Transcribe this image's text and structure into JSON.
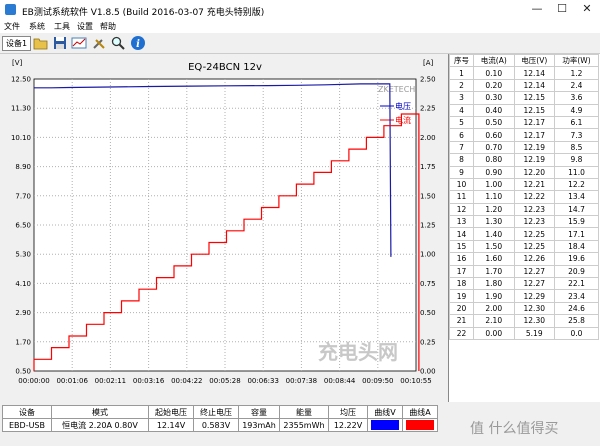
{
  "window": {
    "title": "EB测试系统软件 V1.8.5 (Build 2016-03-07 充电头特别版)",
    "minimize": "—",
    "maximize": "☐",
    "close": "✕"
  },
  "menu": [
    "文件",
    "系统",
    "工具",
    "设置",
    "帮助"
  ],
  "toolbar": {
    "device_button": "设备1",
    "icons": [
      "folder-open-icon",
      "save-icon",
      "chart-view-icon",
      "tools-icon",
      "zoom-icon",
      "info-icon"
    ]
  },
  "chart_data": {
    "type": "line",
    "title": "EQ-24BCN 12v",
    "left_axis_unit": "[V]",
    "right_axis_unit": "[A]",
    "left_ticks": [
      "12.50",
      "11.30",
      "10.10",
      "8.90",
      "7.70",
      "6.50",
      "5.30",
      "4.10",
      "2.90",
      "1.70",
      "0.50"
    ],
    "right_ticks": [
      "2.50",
      "2.25",
      "2.00",
      "1.75",
      "1.50",
      "1.25",
      "1.00",
      "0.75",
      "0.50",
      "0.25",
      "0.00"
    ],
    "x_ticks": [
      "00:00:00",
      "00:01:06",
      "00:02:11",
      "00:03:16",
      "00:04:22",
      "00:05:28",
      "00:06:33",
      "00:07:38",
      "00:08:44",
      "00:09:50",
      "00:10:55"
    ],
    "ylim_left": [
      0.5,
      12.5
    ],
    "ylim_right": [
      0.0,
      2.5
    ],
    "watermark": "ZKETECH",
    "legend": [
      {
        "name": "电压",
        "color": "#0000cc"
      },
      {
        "name": "电流",
        "color": "#ff0000"
      }
    ],
    "voltage_series": {
      "name": "电压",
      "color": "#1a1aa8",
      "x": [
        0,
        30,
        60,
        130,
        200,
        270,
        330,
        400,
        450,
        500,
        560,
        600,
        610,
        612
      ],
      "y": [
        12.14,
        12.14,
        12.15,
        12.17,
        12.19,
        12.21,
        12.22,
        12.23,
        12.24,
        12.26,
        12.3,
        12.3,
        12.3,
        5.19
      ]
    },
    "current_series": {
      "name": "电流",
      "color": "#ff0000",
      "steps": [
        0.1,
        0.2,
        0.3,
        0.4,
        0.5,
        0.6,
        0.7,
        0.8,
        0.9,
        1.0,
        1.1,
        1.2,
        1.3,
        1.4,
        1.5,
        1.6,
        1.7,
        1.8,
        1.9,
        2.0,
        2.1,
        2.2
      ],
      "step_seconds": 30,
      "end_value": 0.0
    }
  },
  "points_table": {
    "headers": [
      "序号",
      "电流(A)",
      "电压(V)",
      "功率(W)"
    ],
    "rows": [
      [
        "1",
        "0.10",
        "12.14",
        "1.2"
      ],
      [
        "2",
        "0.20",
        "12.14",
        "2.4"
      ],
      [
        "3",
        "0.30",
        "12.15",
        "3.6"
      ],
      [
        "4",
        "0.40",
        "12.15",
        "4.9"
      ],
      [
        "5",
        "0.50",
        "12.17",
        "6.1"
      ],
      [
        "6",
        "0.60",
        "12.17",
        "7.3"
      ],
      [
        "7",
        "0.70",
        "12.19",
        "8.5"
      ],
      [
        "8",
        "0.80",
        "12.19",
        "9.8"
      ],
      [
        "9",
        "0.90",
        "12.20",
        "11.0"
      ],
      [
        "10",
        "1.00",
        "12.21",
        "12.2"
      ],
      [
        "11",
        "1.10",
        "12.22",
        "13.4"
      ],
      [
        "12",
        "1.20",
        "12.23",
        "14.7"
      ],
      [
        "13",
        "1.30",
        "12.23",
        "15.9"
      ],
      [
        "14",
        "1.40",
        "12.25",
        "17.1"
      ],
      [
        "15",
        "1.50",
        "12.25",
        "18.4"
      ],
      [
        "16",
        "1.60",
        "12.26",
        "19.6"
      ],
      [
        "17",
        "1.70",
        "12.27",
        "20.9"
      ],
      [
        "18",
        "1.80",
        "12.27",
        "22.1"
      ],
      [
        "19",
        "1.90",
        "12.29",
        "23.4"
      ],
      [
        "20",
        "2.00",
        "12.30",
        "24.6"
      ],
      [
        "21",
        "2.10",
        "12.30",
        "25.8"
      ],
      [
        "22",
        "0.00",
        "5.19",
        "0.0"
      ]
    ]
  },
  "summary": {
    "headers": [
      "设备",
      "模式",
      "起始电压",
      "终止电压",
      "容量",
      "能量",
      "均压",
      "曲线V",
      "曲线A"
    ],
    "values": [
      "EBD-USB",
      "恒电流  2.20A  0.80V",
      "12.14V",
      "0.583V",
      "193mAh",
      "2355mWh",
      "12.22V"
    ],
    "curve_v_color": "#0000ff",
    "curve_a_color": "#ff0000"
  },
  "corner_watermark": "值 什么值得买"
}
